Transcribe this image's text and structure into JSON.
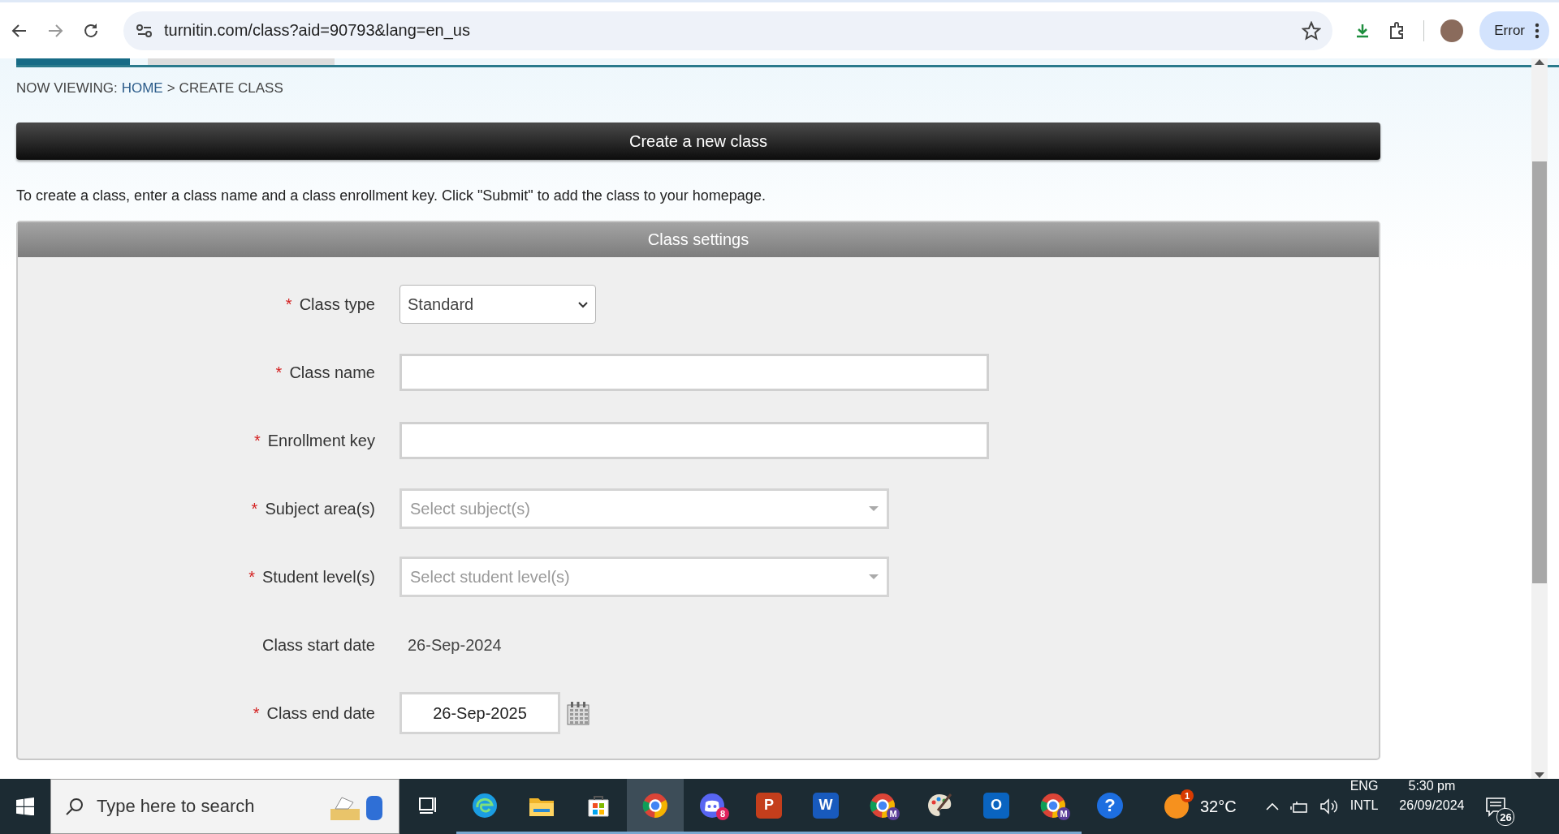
{
  "browser": {
    "url": "turnitin.com/class?aid=90793&lang=en_us",
    "profile_label": "Error"
  },
  "breadcrumb": {
    "prefix": "NOW VIEWING:",
    "link": "HOME",
    "separator": ">",
    "current": "CREATE CLASS"
  },
  "header": {
    "title": "Create a new class"
  },
  "intro": "To create a class, enter a class name and a class enrollment key. Click \"Submit\" to add the class to your homepage.",
  "panel": {
    "title": "Class settings",
    "required_marker": "*",
    "fields": [
      {
        "kind": "select",
        "label": "Class type",
        "required": true,
        "value": "Standard"
      },
      {
        "kind": "input",
        "label": "Class name",
        "required": true
      },
      {
        "kind": "input",
        "label": "Enrollment key",
        "required": true
      },
      {
        "kind": "multiselect",
        "label": "Subject area(s)",
        "required": true,
        "placeholder": "Select subject(s)"
      },
      {
        "kind": "multiselect",
        "label": "Student level(s)",
        "required": true,
        "placeholder": "Select student level(s)"
      },
      {
        "kind": "text",
        "label": "Class start date",
        "required": false,
        "value": "26-Sep-2024"
      },
      {
        "kind": "date",
        "label": "Class end date",
        "required": true,
        "value": "26-Sep-2025"
      }
    ]
  },
  "taskbar": {
    "search_placeholder": "Type here to search",
    "apps": [
      {
        "kind": "taskview",
        "selected": false,
        "running": false
      },
      {
        "kind": "edge",
        "selected": false,
        "running": true
      },
      {
        "kind": "folder",
        "selected": false,
        "running": true
      },
      {
        "kind": "store",
        "selected": false,
        "running": true
      },
      {
        "kind": "chrome",
        "selected": true,
        "running": true
      },
      {
        "kind": "chat",
        "selected": false,
        "running": true,
        "badge": "8"
      },
      {
        "kind": "office",
        "selected": false,
        "running": true,
        "letter": "P",
        "color": "#c43e1c"
      },
      {
        "kind": "office",
        "selected": false,
        "running": true,
        "letter": "W",
        "color": "#185abd"
      },
      {
        "kind": "chrome",
        "selected": false,
        "running": true,
        "badge": "M"
      },
      {
        "kind": "palette",
        "selected": false,
        "running": true
      },
      {
        "kind": "office",
        "selected": false,
        "running": true,
        "letter": "O",
        "color": "#0a64c0"
      },
      {
        "kind": "chrome",
        "selected": false,
        "running": true,
        "badge": "M"
      },
      {
        "kind": "help",
        "selected": false,
        "running": false,
        "letter": "?"
      }
    ],
    "weather": {
      "badge": "1",
      "temperature": "32°C"
    },
    "language": [
      "ENG",
      "INTL"
    ],
    "time": "5:30 pm",
    "date": "26/09/2024",
    "notifications": "26"
  }
}
